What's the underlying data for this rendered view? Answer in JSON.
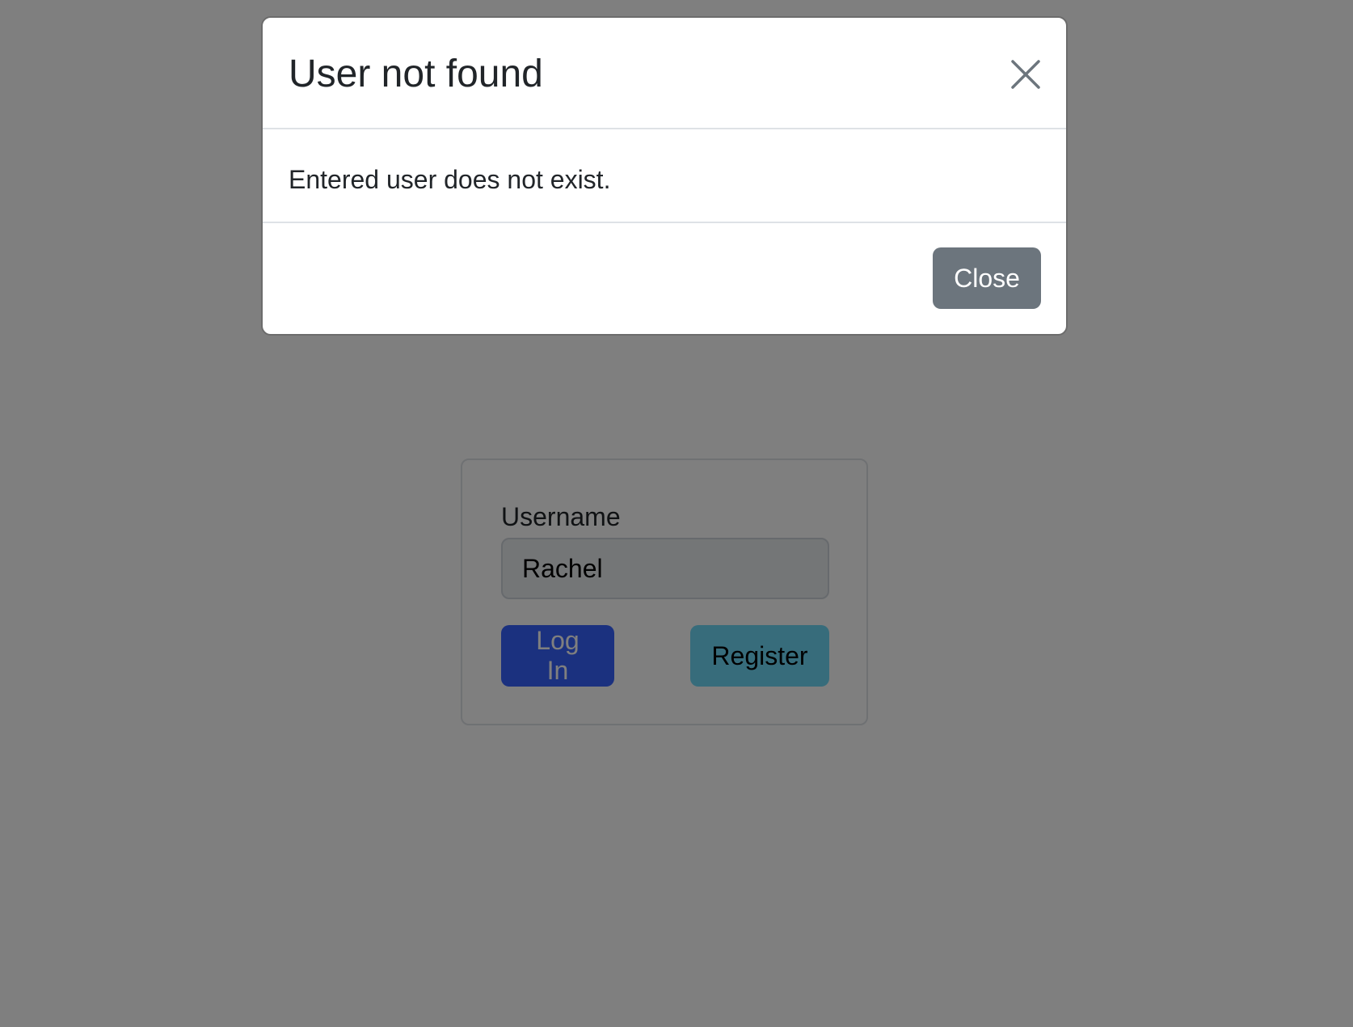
{
  "login": {
    "username_label": "Username",
    "username_value": "Rachel",
    "login_button": "Log In",
    "register_button": "Register"
  },
  "modal": {
    "title": "User not found",
    "close_icon": "close-icon",
    "message": "Entered user does not exist.",
    "close_button": "Close"
  },
  "colors": {
    "login_button": "#3763ff",
    "register_button": "#6ed8f6",
    "close_button": "#6c757d",
    "backdrop": "rgba(0,0,0,0.5)"
  }
}
